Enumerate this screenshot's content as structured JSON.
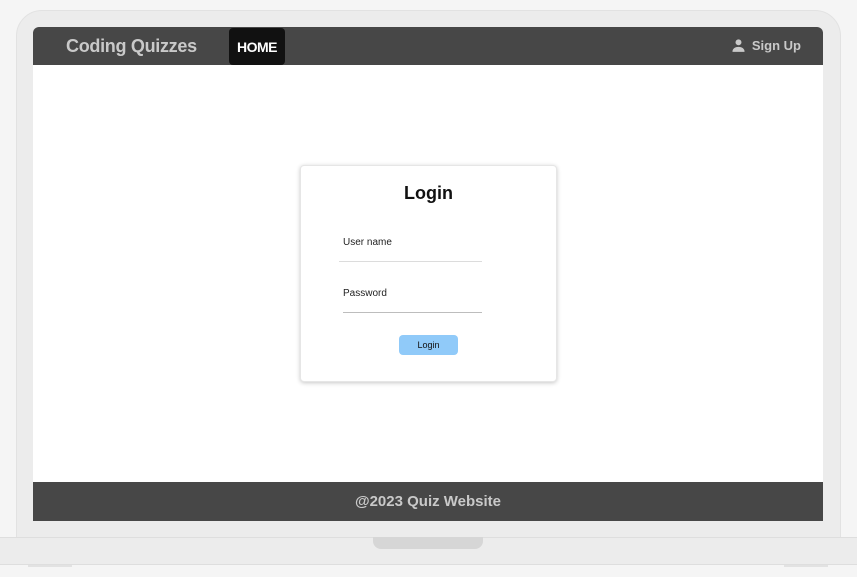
{
  "navbar": {
    "brand": "Coding Quizzes",
    "home_label": "HOME",
    "signup_label": "Sign Up",
    "signup_icon": "person-icon"
  },
  "login": {
    "title": "Login",
    "username_label": "User name",
    "password_label": "Password",
    "button_label": "Login",
    "button_color": "#90caf9"
  },
  "footer": {
    "text": "@2023 Quiz Website"
  },
  "colors": {
    "nav_bg": "#474747",
    "active_nav_bg": "#111111",
    "nav_text": "#c9c9c9"
  }
}
